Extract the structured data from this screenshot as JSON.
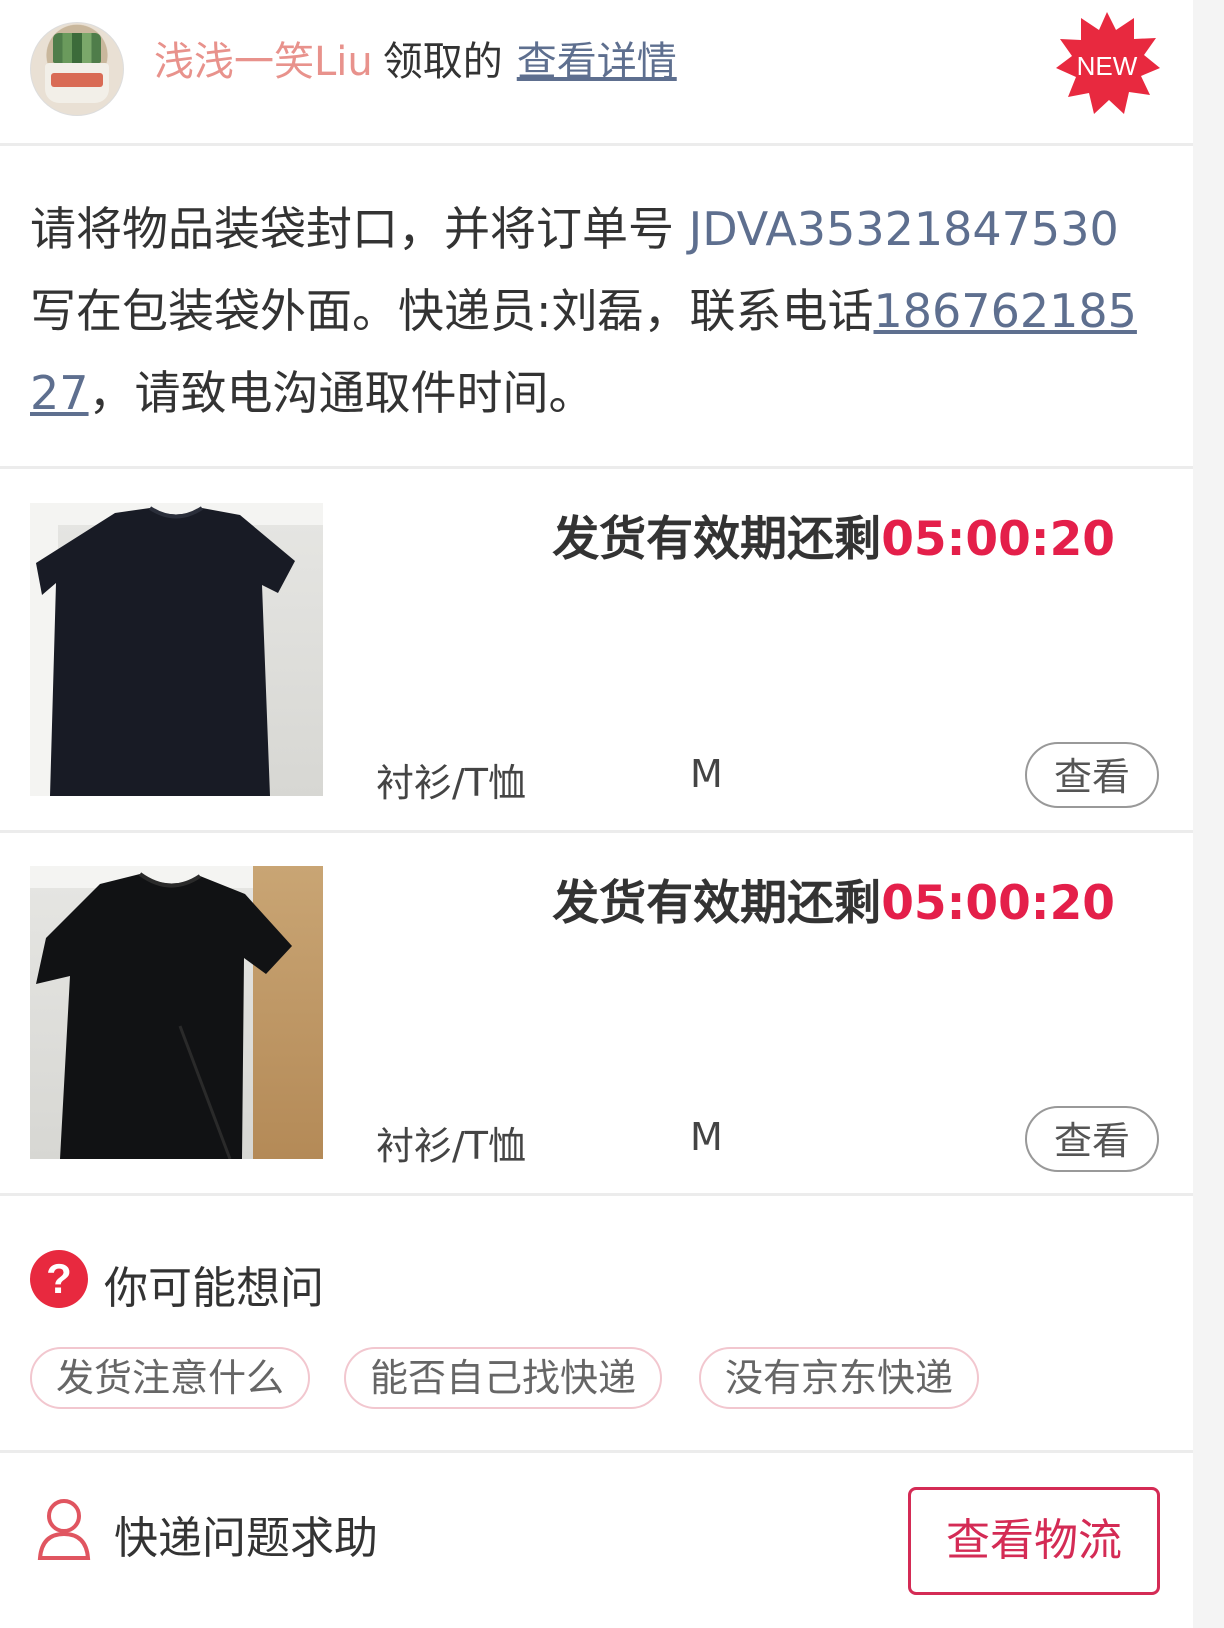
{
  "header": {
    "name": "浅浅一笑Liu",
    "action": "领取的",
    "detail_link": "查看详情",
    "badge": "NEW"
  },
  "notice": {
    "part1": "请将物品装袋封口，并将订单号 ",
    "order_no": "JDVA35321847530",
    "part2": " 写在包装袋外面。快递员:刘磊，联系电话",
    "phone": "18676218527",
    "part3": "，请致电沟通取件时间。"
  },
  "items": [
    {
      "deadline_label": "发货有效期还剩",
      "deadline_time": "05:00:20",
      "category": "衬衫/T恤",
      "size": "M",
      "view_label": "查看"
    },
    {
      "deadline_label": "发货有效期还剩",
      "deadline_time": "05:00:20",
      "category": "衬衫/T恤",
      "size": "M",
      "view_label": "查看"
    }
  ],
  "faq": {
    "title": "你可能想问",
    "chips": [
      "发货注意什么",
      "能否自己找快递",
      "没有京东快递"
    ]
  },
  "footer": {
    "help_label": "快递问题求助",
    "track_button": "查看物流"
  },
  "colors": {
    "accent": "#e41f4a",
    "link": "#5e6f8f",
    "name": "#e8928c",
    "button_border": "#d42b55"
  }
}
